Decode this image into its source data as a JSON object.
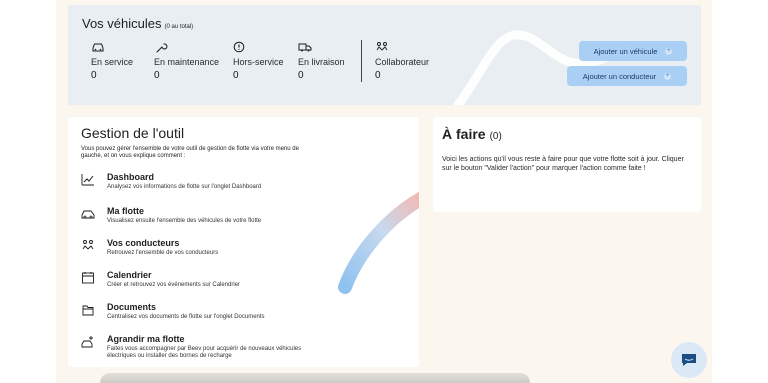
{
  "vehicles": {
    "title": "Vos véhicules",
    "total": "(0 au total)",
    "stats": [
      {
        "icon": "car-icon",
        "label": "En service",
        "value": "0"
      },
      {
        "icon": "wrench-icon",
        "label": "En maintenance",
        "value": "0"
      },
      {
        "icon": "warning-circle-icon",
        "label": "Hors-service",
        "value": "0"
      },
      {
        "icon": "truck-icon",
        "label": "En livraison",
        "value": "0"
      },
      {
        "icon": "collaborator-icon",
        "label": "Collaborateur",
        "value": "0"
      }
    ],
    "add_vehicle": "Ajouter un véhicule",
    "add_driver": "Ajouter un conducteur"
  },
  "tool": {
    "title": "Gestion de l'outil",
    "intro": "Vous pouvez gérer l'ensemble de votre outil de gestion de flotte via votre menu de gauche, et on vous explique comment :",
    "items": [
      {
        "icon": "chart-icon",
        "name": "Dashboard",
        "desc": "Analysez vos informations de flotte sur l'onglet Dashboard"
      },
      {
        "icon": "car-outline-icon",
        "name": "Ma flotte",
        "desc": "Visualisez ensuite l'ensemble des véhicules de votre flotte"
      },
      {
        "icon": "drivers-icon",
        "name": "Vos conducteurs",
        "desc": "Retrouvez l'ensemble de vos conducteurs"
      },
      {
        "icon": "calendar-icon",
        "name": "Calendrier",
        "desc": "Créer et retrouvez vos événements sur Calendrier"
      },
      {
        "icon": "documents-icon",
        "name": "Documents",
        "desc": "Centralisez vos documents de flotte sur l'onglet Documents"
      },
      {
        "icon": "expand-fleet-icon",
        "name": "Agrandir ma flotte",
        "desc": "Faites vous accompagner par Beev pour acquérir de nouveaux véhicules électriques ou installer des bornes de recharge"
      }
    ]
  },
  "todo": {
    "title": "À faire",
    "count": "(0)",
    "text": "Voici les actions qu'il vous reste à faire pour que votre flotte soit à jour. Cliquer sur le bouton \"Valider l'action\" pour marquer l'action comme faite !"
  },
  "colors": {
    "panel": "#e8eef1",
    "button": "#a9cff5",
    "background": "#fbf7ee"
  }
}
